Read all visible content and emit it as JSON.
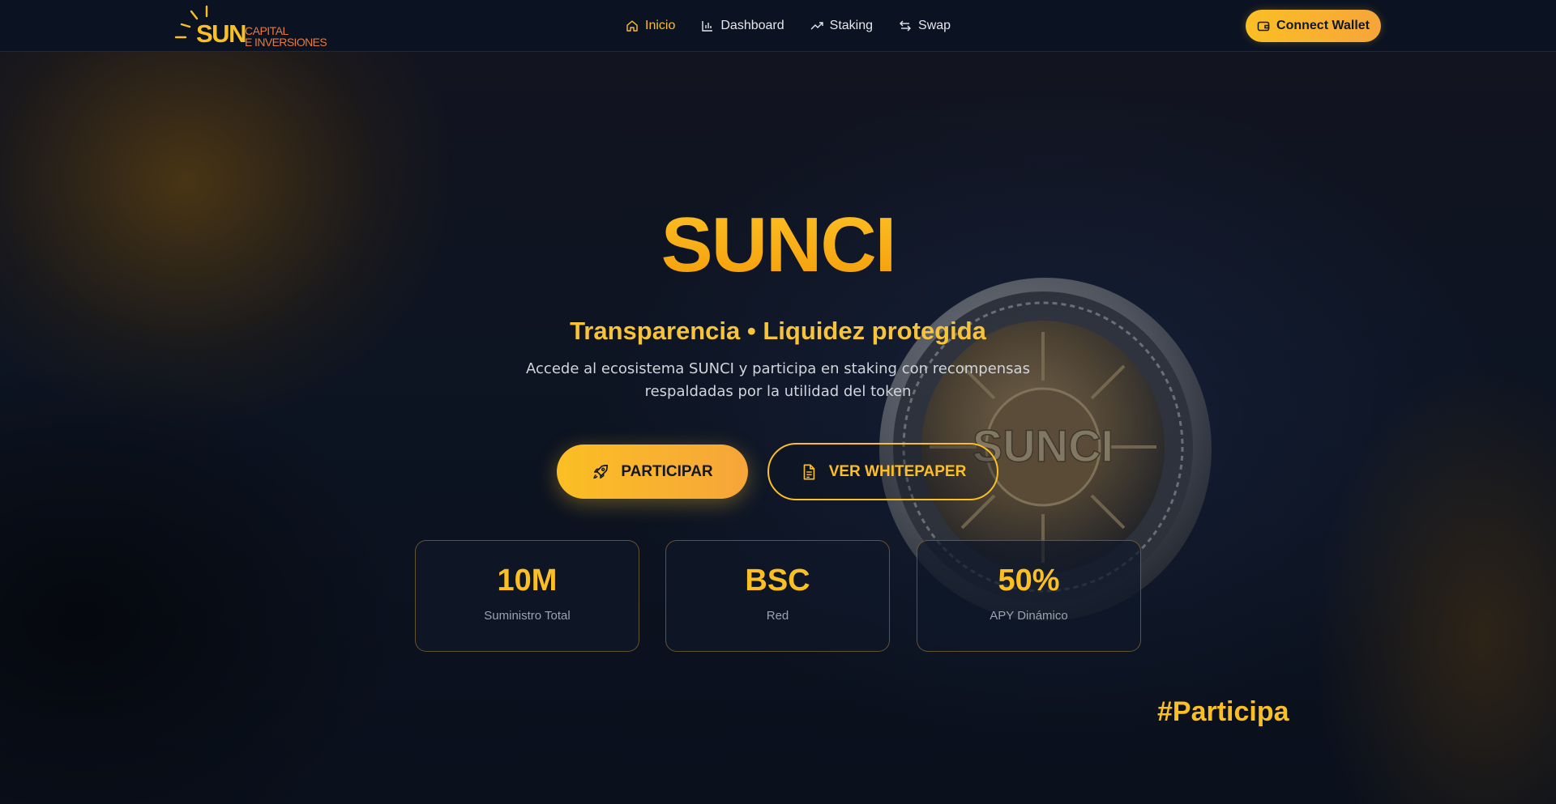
{
  "navbar": {
    "logo": {
      "word": "SUN",
      "line1": "CAPITAL",
      "line2": "E INVERSIONES",
      "icon": "sun-rays-icon"
    },
    "links": [
      {
        "label": "Inicio",
        "icon": "home-icon",
        "active": true
      },
      {
        "label": "Dashboard",
        "icon": "bar-chart-icon",
        "active": false
      },
      {
        "label": "Staking",
        "icon": "trending-up-icon",
        "active": false
      },
      {
        "label": "Swap",
        "icon": "swap-arrows-icon",
        "active": false
      }
    ],
    "connect_wallet": {
      "label": "Connect Wallet",
      "icon": "wallet-icon"
    }
  },
  "hero": {
    "title": "SUNCI",
    "tagline": "Transparencia • Liquidez protegida",
    "description_line1": "Accede al ecosistema SUNCI y participa en staking con recompensas",
    "description_line2": "respaldadas por la utilidad del token",
    "coin_label": "SUNCI",
    "primary_button": {
      "label": "PARTICIPAR",
      "icon": "rocket-icon"
    },
    "secondary_button": {
      "label": "VER WHITEPAPER",
      "icon": "document-icon"
    }
  },
  "stats": [
    {
      "value": "10M",
      "label": "Suministro Total"
    },
    {
      "value": "BSC",
      "label": "Red"
    },
    {
      "value": "50%",
      "label": "APY Dinámico"
    }
  ],
  "hashtag": "#Participa",
  "colors": {
    "accent": "#fbbf24",
    "accent_orange": "#f59e0b",
    "background": "#0b1220",
    "text_muted": "#9ca3af"
  }
}
